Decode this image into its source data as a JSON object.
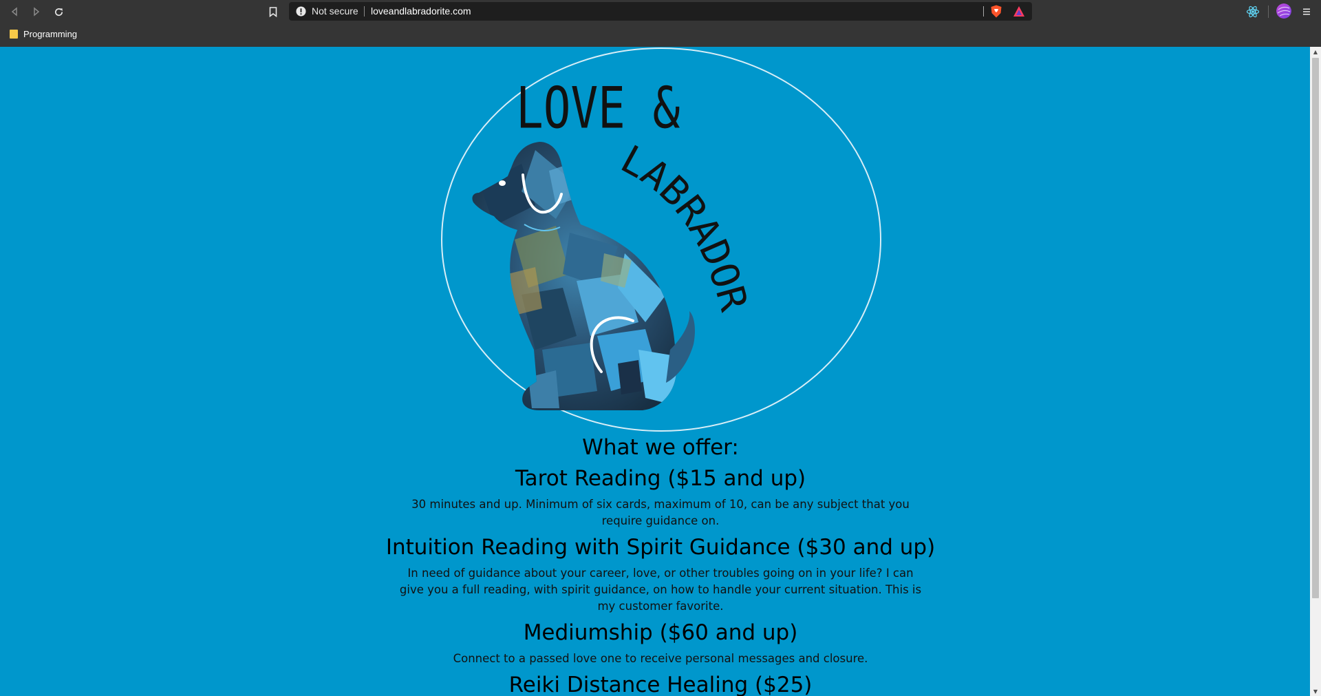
{
  "browser": {
    "security_status": "Not secure",
    "url": "loveandlabradorite.com",
    "bookmarks": [
      {
        "label": "Programming"
      }
    ],
    "icons": {
      "back": "arrow-left-icon",
      "forward": "arrow-right-icon",
      "reload": "reload-icon",
      "bookmark": "bookmark-icon",
      "warning": "warning-icon",
      "shield": "brave-shield-icon",
      "rewards": "brave-rewards-icon",
      "extension": "react-extension-icon",
      "menu": "hamburger-menu-icon"
    }
  },
  "logo": {
    "line1": "LOVE &",
    "line2": "LABRADORITE"
  },
  "page": {
    "heading": "What we offer:",
    "services": [
      {
        "title": "Tarot Reading ($15 and up)",
        "description": "30 minutes and up. Minimum of six cards, maximum of 10, can be any subject that you require guidance on."
      },
      {
        "title": "Intuition Reading with Spirit Guidance ($30 and up)",
        "description": "In need of guidance about your career, love, or other troubles going on in your life? I can give you a full reading, with spirit guidance, on how to handle your current situation. This is my customer favorite."
      },
      {
        "title": "Mediumship ($60 and up)",
        "description": "Connect to a passed love one to receive personal messages and closure."
      },
      {
        "title": "Reiki Distance Healing ($25)",
        "description": ""
      }
    ]
  },
  "colors": {
    "page_background": "#0097cc",
    "chrome_background": "#353535",
    "omnibox_background": "#1e1e1e"
  }
}
